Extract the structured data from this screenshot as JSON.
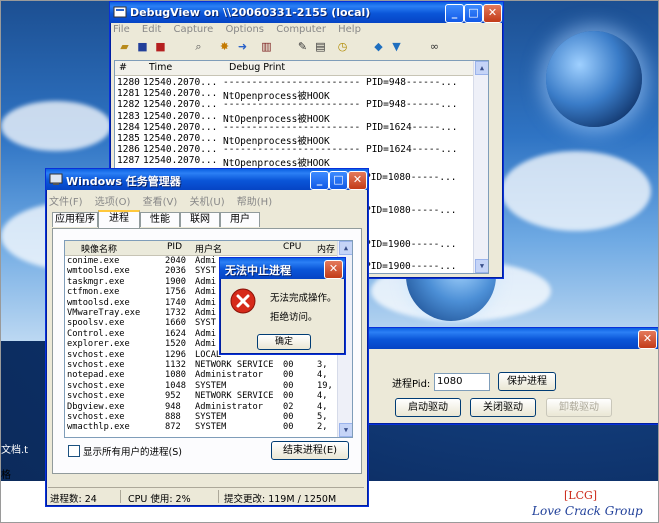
{
  "debugview": {
    "title": "DebugView on \\\\20060331-2155 (local)",
    "menu": [
      "File",
      "Edit",
      "Capture",
      "Options",
      "Computer",
      "Help"
    ],
    "columns": [
      "#",
      "Time",
      "Debug Print"
    ],
    "rows": [
      {
        "n": "1280",
        "t": "12540.2070...",
        "m": "------------------------ PID=948------..."
      },
      {
        "n": "1281",
        "t": "12540.2070...",
        "m": "NtOpenprocess被HOOK"
      },
      {
        "n": "1282",
        "t": "12540.2070...",
        "m": "------------------------ PID=948------..."
      },
      {
        "n": "1283",
        "t": "12540.2070...",
        "m": "NtOpenprocess被HOOK"
      },
      {
        "n": "1284",
        "t": "12540.2070...",
        "m": "------------------------ PID=1624-----..."
      },
      {
        "n": "1285",
        "t": "12540.2070...",
        "m": "NtOpenprocess被HOOK"
      },
      {
        "n": "1286",
        "t": "12540.2070...",
        "m": "------------------------ PID=1624-----..."
      },
      {
        "n": "1287",
        "t": "12540.2070...",
        "m": "NtOpenprocess被HOOK"
      }
    ],
    "partial_right": [
      "PID=1080-----...",
      "PID=1080-----...",
      "PID=1900-----...",
      "PID=1900-----..."
    ]
  },
  "taskmgr": {
    "title": "Windows 任务管理器",
    "menu": [
      "文件(F)",
      "选项(O)",
      "查看(V)",
      "关机(U)",
      "帮助(H)"
    ],
    "tabs": [
      "应用程序",
      "进程",
      "性能",
      "联网",
      "用户"
    ],
    "columns": [
      "映像名称",
      "PID",
      "用户名",
      "CPU",
      "内存"
    ],
    "rows": [
      {
        "name": "conime.exe",
        "pid": "2040",
        "user": "Admi",
        "cpu": "",
        "mem": ""
      },
      {
        "name": "wmtoolsd.exe",
        "pid": "2036",
        "user": "SYST",
        "cpu": "",
        "mem": ""
      },
      {
        "name": "taskmgr.exe",
        "pid": "1900",
        "user": "Admi",
        "cpu": "",
        "mem": ""
      },
      {
        "name": "ctfmon.exe",
        "pid": "1756",
        "user": "Admi",
        "cpu": "",
        "mem": ""
      },
      {
        "name": "wmtoolsd.exe",
        "pid": "1740",
        "user": "Admi",
        "cpu": "",
        "mem": ""
      },
      {
        "name": "VMwareTray.exe",
        "pid": "1732",
        "user": "Admi",
        "cpu": "",
        "mem": ""
      },
      {
        "name": "spoolsv.exe",
        "pid": "1660",
        "user": "SYST",
        "cpu": "",
        "mem": ""
      },
      {
        "name": "Control.exe",
        "pid": "1624",
        "user": "Admi",
        "cpu": "",
        "mem": ""
      },
      {
        "name": "explorer.exe",
        "pid": "1520",
        "user": "Admi",
        "cpu": "",
        "mem": ""
      },
      {
        "name": "svchost.exe",
        "pid": "1296",
        "user": "LOCAL",
        "cpu": "",
        "mem": ""
      },
      {
        "name": "svchost.exe",
        "pid": "1132",
        "user": "NETWORK SERVICE",
        "cpu": "00",
        "mem": "3,"
      },
      {
        "name": "notepad.exe",
        "pid": "1080",
        "user": "Administrator",
        "cpu": "00",
        "mem": "4,"
      },
      {
        "name": "svchost.exe",
        "pid": "1048",
        "user": "SYSTEM",
        "cpu": "00",
        "mem": "19,"
      },
      {
        "name": "svchost.exe",
        "pid": "952",
        "user": "NETWORK SERVICE",
        "cpu": "00",
        "mem": "4,"
      },
      {
        "name": "Dbgview.exe",
        "pid": "948",
        "user": "Administrator",
        "cpu": "02",
        "mem": "4,"
      },
      {
        "name": "svchost.exe",
        "pid": "888",
        "user": "SYSTEM",
        "cpu": "00",
        "mem": "5,"
      },
      {
        "name": "wmacthlp.exe",
        "pid": "872",
        "user": "SYSTEM",
        "cpu": "00",
        "mem": "2,"
      }
    ],
    "show_all_label": "显示所有用户的进程(S)",
    "end_process_label": "结束进程(E)",
    "status_procs": "进程数: 24",
    "status_cpu": "CPU 使用: 2%",
    "status_commit": "提交更改: 119M / 1250M"
  },
  "dialog": {
    "title": "无法中止进程",
    "line1": "无法完成操作。",
    "line2": "拒绝访问。",
    "ok_label": "确定"
  },
  "tool": {
    "pid_label": "进程Pid:",
    "pid_value": "1080",
    "protect_label": "保护进程",
    "start_driver_label": "启动驱动",
    "stop_driver_label": "关闭驱动",
    "unload_driver_label": "卸载驱动"
  },
  "background": {
    "left_text_1": "文档.t",
    "left_text_2": "格",
    "brand_1": "[LCG]",
    "brand_2": "Love Crack Group"
  },
  "colors": {
    "titlebar": "#0a5fe0",
    "close": "#c23b18",
    "brand_red": "#cc2a1a",
    "brand_blue": "#1f3f99"
  }
}
